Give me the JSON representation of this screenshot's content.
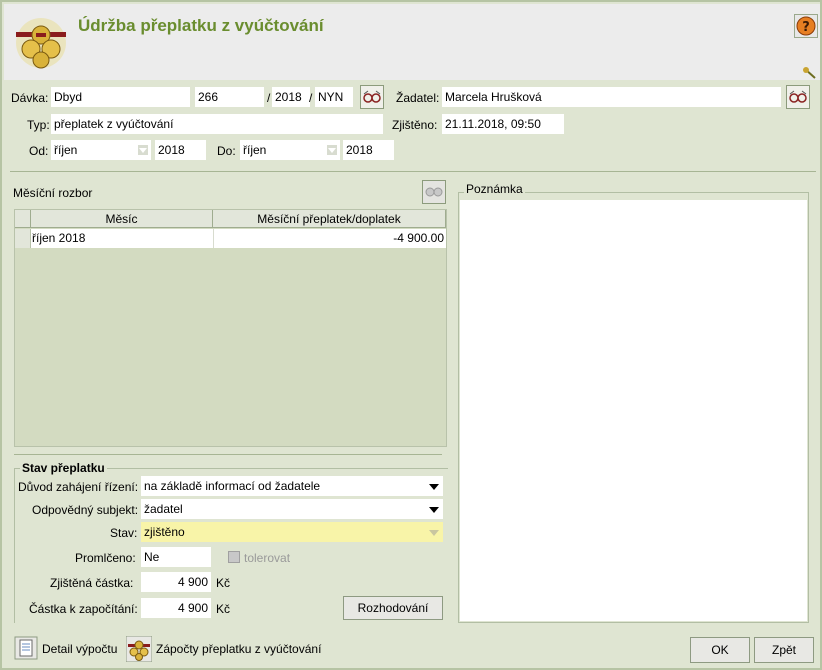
{
  "header": {
    "title": "Údržba přeplatku z vyúčtování",
    "help_icon": "question-icon"
  },
  "form": {
    "davka_label": "Dávka:",
    "davka_value": "Dbyd",
    "davka_number": "266",
    "slash1": "/",
    "davka_year": "2018",
    "slash2": "/",
    "davka_code": "NYN",
    "zadatel_label": "Žadatel:",
    "zadatel_value": "Marcela Hrušková",
    "typ_label": "Typ:",
    "typ_value": "přeplatek z vyúčtování",
    "zjisteno_label": "Zjištěno:",
    "zjisteno_value": "21.11.2018, 09:50",
    "od_label": "Od:",
    "od_month": "říjen",
    "od_year": "2018",
    "do_label": "Do:",
    "do_month": "říjen",
    "do_year": "2018"
  },
  "rozbor": {
    "label": "Měsíční rozbor",
    "columns": [
      "Měsíc",
      "Měsíční přeplatek/doplatek"
    ],
    "rows": [
      {
        "month": "říjen 2018",
        "amount": "-4 900.00"
      }
    ]
  },
  "poznamka": {
    "label": "Poznámka"
  },
  "stav": {
    "legend": "Stav přeplatku",
    "duvod_label": "Důvod zahájení řízení:",
    "duvod_value": "na základě informací od žadatele",
    "subjekt_label": "Odpovědný subjekt:",
    "subjekt_value": "žadatel",
    "stav_label": "Stav:",
    "stav_value": "zjištěno",
    "promlceno_label": "Promlčeno:",
    "promlceno_value": "Ne",
    "tolerovat_label": "tolerovat",
    "zjistena_label": "Zjištěná částka:",
    "zjistena_value": "4 900",
    "zjistena_unit": "Kč",
    "zapocitani_label": "Částka k započítání:",
    "zapocitani_value": "4 900",
    "zapocitani_unit": "Kč",
    "rozhodovani_button": "Rozhodování"
  },
  "footer": {
    "detail_label": "Detail výpočtu",
    "zapocty_label": "Zápočty přeplatku z vyúčtování",
    "ok_button": "OK",
    "zpet_button": "Zpět"
  },
  "colors": {
    "title": "#6a8d2f",
    "background": "#dfe5d2",
    "stav_highlight": "#f8f4a8"
  }
}
